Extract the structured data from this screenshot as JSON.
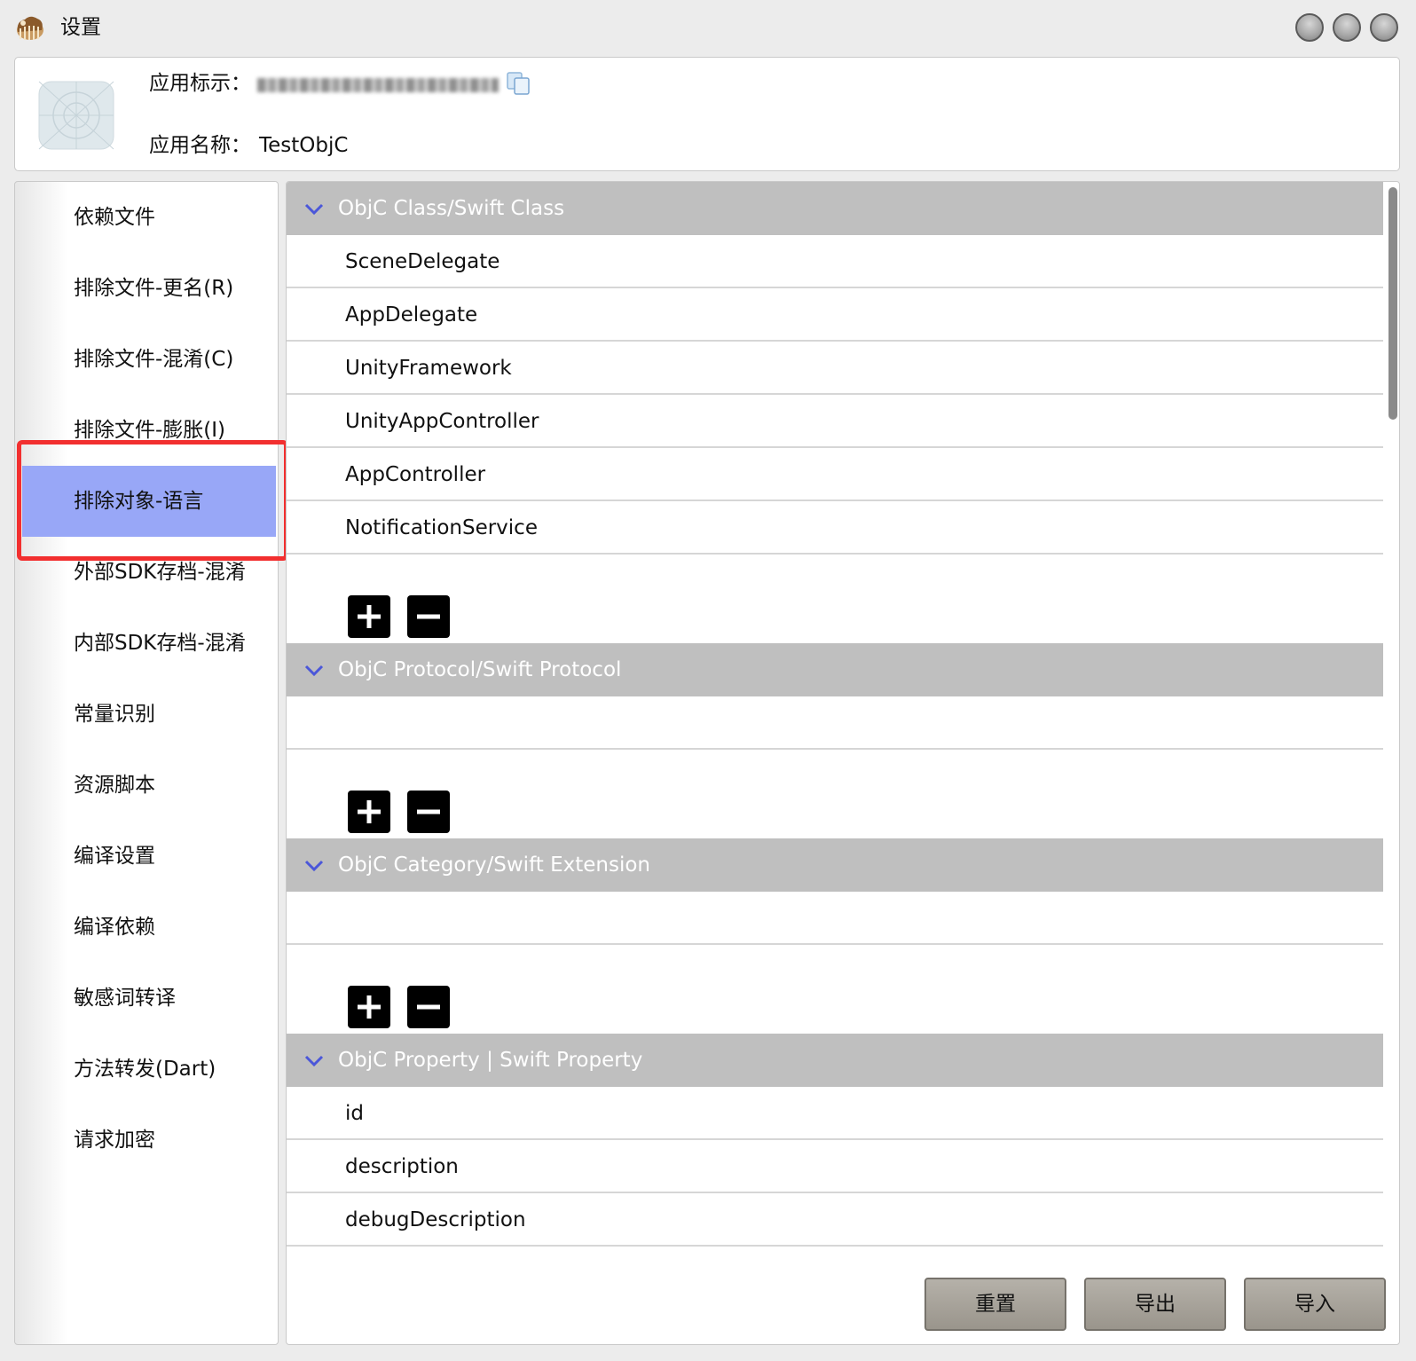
{
  "window": {
    "title": "设置"
  },
  "app_info": {
    "identifier_label": "应用标示：",
    "name_label": "应用名称：",
    "name_value": "TestObjC"
  },
  "sidebar": {
    "selected_index": 4,
    "items": [
      {
        "label": "依赖文件"
      },
      {
        "label": "排除文件-更名(R)"
      },
      {
        "label": "排除文件-混淆(C)"
      },
      {
        "label": "排除文件-膨胀(I)"
      },
      {
        "label": "排除对象-语言"
      },
      {
        "label": "外部SDK存档-混淆"
      },
      {
        "label": "内部SDK存档-混淆"
      },
      {
        "label": "常量识别"
      },
      {
        "label": "资源脚本"
      },
      {
        "label": "编译设置"
      },
      {
        "label": "编译依赖"
      },
      {
        "label": "敏感词转译"
      },
      {
        "label": "方法转发(Dart)"
      },
      {
        "label": "请求加密"
      }
    ]
  },
  "sections": [
    {
      "title": "ObjC Class/Swift Class",
      "rows": [
        "SceneDelegate",
        "AppDelegate",
        "UnityFramework",
        "UnityAppController",
        "AppController",
        "NotificationService"
      ]
    },
    {
      "title": "ObjC Protocol/Swift Protocol",
      "rows": []
    },
    {
      "title": "ObjC Category/Swift Extension",
      "rows": []
    },
    {
      "title": "ObjC Property | Swift Property",
      "rows": [
        "id",
        "description",
        "debugDescription"
      ]
    }
  ],
  "buttons": {
    "reset": "重置",
    "export": "导出",
    "import": "导入"
  },
  "colors": {
    "selection": "#98a7f7",
    "highlight_border": "#f22f2f",
    "section_header": "#bfbfbf",
    "chevron": "#4b57d9"
  }
}
